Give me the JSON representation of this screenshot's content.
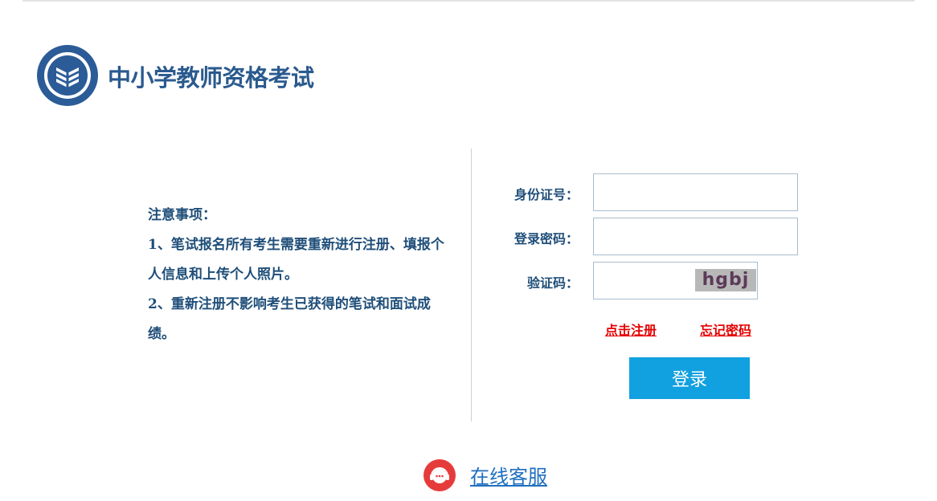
{
  "header": {
    "site_title": "中小学教师资格考试",
    "logo_icon": "book-emblem-icon"
  },
  "notice": {
    "title": "注意事项：",
    "items": [
      "1、笔试报名所有考生需要重新进行注册、填报个人信息和上传个人照片。",
      "2、重新注册不影响考生已获得的笔试和面试成绩。"
    ]
  },
  "login_form": {
    "id_label": "身份证号：",
    "id_value": "",
    "password_label": "登录密码：",
    "password_value": "",
    "captcha_label": "验证码：",
    "captcha_value": "",
    "captcha_image_text": "hgbj",
    "register_link": "点击注册",
    "forgot_link": "忘记密码",
    "login_button": "登录"
  },
  "service": {
    "label": "在线客服",
    "icon": "headset-support-icon"
  },
  "colors": {
    "title_blue": "#2a5a8e",
    "text_blue": "#1f4e79",
    "link_red": "#e60000",
    "button_blue": "#11a0e0",
    "service_red": "#e63b3b"
  }
}
